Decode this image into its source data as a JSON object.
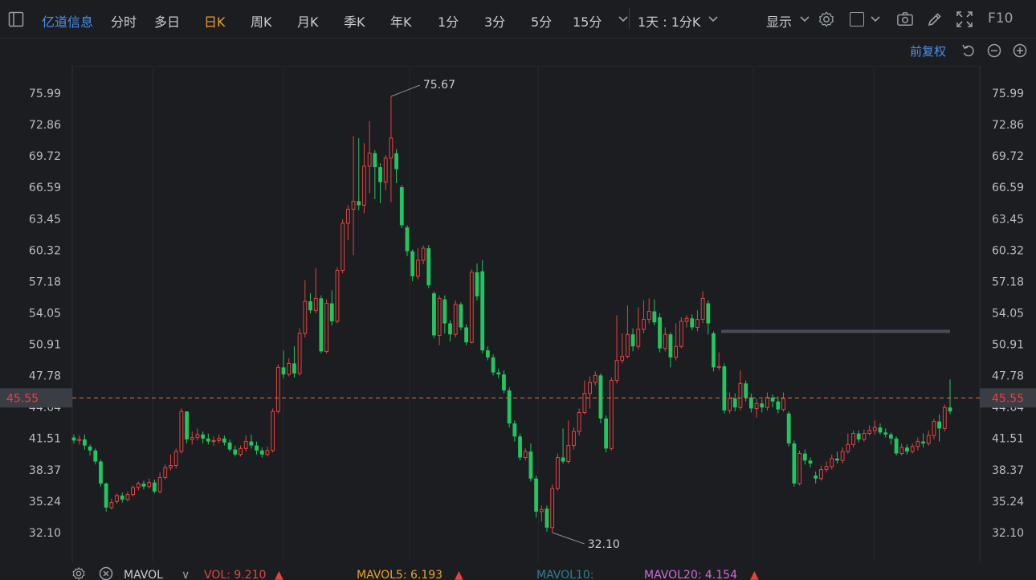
{
  "stock_name": "亿道信息",
  "periods": [
    "分时",
    "多日",
    "日K",
    "周K",
    "月K",
    "季K",
    "年K",
    "1分",
    "3分",
    "5分",
    "15分"
  ],
  "active_period": "日K",
  "interval_selector": "1天 : 1分K",
  "display_menu": "显示",
  "f10_label": "F10",
  "adjust_label": "前复权",
  "current_price": "45.55",
  "high_label": "75.67",
  "low_label": "32.10",
  "colors": {
    "up": "#e8423f",
    "down": "#22c55e",
    "accent": "#f0a020",
    "link": "#4d8fe8",
    "bg": "#1b1d21"
  },
  "chart_data": {
    "type": "candlestick",
    "y_ticks": [
      "75.99",
      "72.86",
      "69.72",
      "66.59",
      "63.45",
      "60.32",
      "57.18",
      "54.05",
      "50.91",
      "47.78",
      "44.64",
      "41.51",
      "38.37",
      "35.24",
      "32.10"
    ],
    "ylim": [
      32.1,
      75.99
    ],
    "reference_price": 45.55,
    "candles": [
      {
        "o": 41.6,
        "c": 41.3,
        "h": 41.9,
        "l": 41.0
      },
      {
        "o": 41.3,
        "c": 41.4,
        "h": 41.8,
        "l": 40.9
      },
      {
        "o": 41.4,
        "c": 40.8,
        "h": 41.9,
        "l": 40.4
      },
      {
        "o": 40.7,
        "c": 40.3,
        "h": 40.9,
        "l": 39.8
      },
      {
        "o": 40.3,
        "c": 39.2,
        "h": 40.5,
        "l": 38.9
      },
      {
        "o": 39.2,
        "c": 37.0,
        "h": 39.4,
        "l": 36.7
      },
      {
        "o": 37.0,
        "c": 34.6,
        "h": 37.1,
        "l": 34.2
      },
      {
        "o": 34.6,
        "c": 35.1,
        "h": 35.5,
        "l": 34.4
      },
      {
        "o": 35.2,
        "c": 35.8,
        "h": 36.0,
        "l": 35.0
      },
      {
        "o": 35.8,
        "c": 35.4,
        "h": 36.1,
        "l": 35.1
      },
      {
        "o": 35.4,
        "c": 35.9,
        "h": 36.2,
        "l": 35.2
      },
      {
        "o": 35.9,
        "c": 36.6,
        "h": 36.8,
        "l": 35.7
      },
      {
        "o": 36.6,
        "c": 37.0,
        "h": 37.2,
        "l": 36.3
      },
      {
        "o": 37.0,
        "c": 36.7,
        "h": 37.3,
        "l": 36.4
      },
      {
        "o": 36.7,
        "c": 37.1,
        "h": 37.5,
        "l": 36.5
      },
      {
        "o": 37.1,
        "c": 36.2,
        "h": 37.4,
        "l": 36.0
      },
      {
        "o": 36.2,
        "c": 37.6,
        "h": 38.1,
        "l": 36.0
      },
      {
        "o": 37.6,
        "c": 38.6,
        "h": 38.9,
        "l": 37.4
      },
      {
        "o": 38.6,
        "c": 38.8,
        "h": 39.9,
        "l": 38.3
      },
      {
        "o": 38.8,
        "c": 40.2,
        "h": 40.5,
        "l": 38.5
      },
      {
        "o": 40.2,
        "c": 44.2,
        "h": 44.5,
        "l": 40.0
      },
      {
        "o": 44.2,
        "c": 41.4,
        "h": 44.2,
        "l": 41.0
      },
      {
        "o": 41.4,
        "c": 41.6,
        "h": 42.2,
        "l": 40.9
      },
      {
        "o": 41.6,
        "c": 41.9,
        "h": 42.5,
        "l": 41.3
      },
      {
        "o": 41.9,
        "c": 41.5,
        "h": 42.2,
        "l": 41.0
      },
      {
        "o": 41.5,
        "c": 41.2,
        "h": 42.0,
        "l": 40.9
      },
      {
        "o": 41.2,
        "c": 41.3,
        "h": 41.7,
        "l": 40.8
      },
      {
        "o": 41.3,
        "c": 41.5,
        "h": 41.9,
        "l": 41.0
      },
      {
        "o": 41.5,
        "c": 41.1,
        "h": 41.8,
        "l": 40.8
      },
      {
        "o": 41.1,
        "c": 40.4,
        "h": 41.4,
        "l": 40.2
      },
      {
        "o": 40.4,
        "c": 39.9,
        "h": 40.8,
        "l": 39.7
      },
      {
        "o": 39.9,
        "c": 40.5,
        "h": 40.8,
        "l": 39.7
      },
      {
        "o": 40.5,
        "c": 41.2,
        "h": 41.8,
        "l": 40.2
      },
      {
        "o": 41.2,
        "c": 40.8,
        "h": 41.9,
        "l": 40.5
      },
      {
        "o": 40.8,
        "c": 40.3,
        "h": 41.2,
        "l": 39.9
      },
      {
        "o": 40.3,
        "c": 39.9,
        "h": 40.6,
        "l": 39.6
      },
      {
        "o": 39.9,
        "c": 40.3,
        "h": 40.7,
        "l": 39.7
      },
      {
        "o": 40.3,
        "c": 44.2,
        "h": 44.5,
        "l": 40.1
      },
      {
        "o": 44.2,
        "c": 48.6,
        "h": 48.9,
        "l": 44.0
      },
      {
        "o": 48.6,
        "c": 47.9,
        "h": 50.3,
        "l": 47.5
      },
      {
        "o": 47.9,
        "c": 49.0,
        "h": 49.5,
        "l": 47.7
      },
      {
        "o": 49.0,
        "c": 48.0,
        "h": 50.7,
        "l": 47.6
      },
      {
        "o": 48.0,
        "c": 52.0,
        "h": 52.5,
        "l": 47.8
      },
      {
        "o": 52.0,
        "c": 55.2,
        "h": 57.3,
        "l": 51.6
      },
      {
        "o": 55.2,
        "c": 54.3,
        "h": 56.0,
        "l": 54.0
      },
      {
        "o": 54.3,
        "c": 55.5,
        "h": 58.5,
        "l": 54.0
      },
      {
        "o": 55.5,
        "c": 50.2,
        "h": 55.8,
        "l": 50.0
      },
      {
        "o": 50.2,
        "c": 55.0,
        "h": 55.4,
        "l": 50.0
      },
      {
        "o": 55.0,
        "c": 53.2,
        "h": 56.3,
        "l": 52.8
      },
      {
        "o": 53.2,
        "c": 58.3,
        "h": 58.6,
        "l": 53.0
      },
      {
        "o": 58.3,
        "c": 63.0,
        "h": 63.4,
        "l": 58.0
      },
      {
        "o": 63.0,
        "c": 64.4,
        "h": 64.8,
        "l": 61.3
      },
      {
        "o": 64.4,
        "c": 65.2,
        "h": 71.7,
        "l": 59.8
      },
      {
        "o": 65.2,
        "c": 64.8,
        "h": 71.5,
        "l": 64.3
      },
      {
        "o": 64.8,
        "c": 68.7,
        "h": 71.0,
        "l": 64.0
      },
      {
        "o": 68.7,
        "c": 70.0,
        "h": 73.2,
        "l": 66.0
      },
      {
        "o": 70.0,
        "c": 68.6,
        "h": 70.3,
        "l": 65.4
      },
      {
        "o": 68.6,
        "c": 67.1,
        "h": 69.0,
        "l": 65.0
      },
      {
        "o": 67.1,
        "c": 69.5,
        "h": 69.8,
        "l": 66.3
      },
      {
        "o": 69.5,
        "c": 71.5,
        "h": 75.67,
        "l": 65.1
      },
      {
        "o": 70.0,
        "c": 68.4,
        "h": 70.4,
        "l": 67.0
      },
      {
        "o": 66.6,
        "c": 62.8,
        "h": 66.8,
        "l": 62.5
      },
      {
        "o": 62.6,
        "c": 60.2,
        "h": 62.8,
        "l": 59.7
      },
      {
        "o": 60.2,
        "c": 57.7,
        "h": 60.4,
        "l": 57.2
      },
      {
        "o": 57.7,
        "c": 59.3,
        "h": 60.5,
        "l": 57.4
      },
      {
        "o": 59.3,
        "c": 60.5,
        "h": 60.8,
        "l": 58.9
      },
      {
        "o": 60.5,
        "c": 56.8,
        "h": 60.8,
        "l": 56.5
      },
      {
        "o": 56.0,
        "c": 51.8,
        "h": 56.2,
        "l": 51.5
      },
      {
        "o": 51.8,
        "c": 55.5,
        "h": 55.8,
        "l": 50.8
      },
      {
        "o": 55.4,
        "c": 53.0,
        "h": 55.8,
        "l": 52.0
      },
      {
        "o": 53.0,
        "c": 51.9,
        "h": 53.3,
        "l": 51.2
      },
      {
        "o": 51.9,
        "c": 54.9,
        "h": 55.3,
        "l": 51.6
      },
      {
        "o": 54.9,
        "c": 52.6,
        "h": 55.1,
        "l": 52.3
      },
      {
        "o": 52.6,
        "c": 51.1,
        "h": 52.9,
        "l": 50.8
      },
      {
        "o": 51.1,
        "c": 58.1,
        "h": 58.4,
        "l": 51.0
      },
      {
        "o": 58.1,
        "c": 55.7,
        "h": 59.0,
        "l": 55.3
      },
      {
        "o": 58.2,
        "c": 50.3,
        "h": 59.3,
        "l": 50.0
      },
      {
        "o": 50.3,
        "c": 49.6,
        "h": 50.7,
        "l": 49.3
      },
      {
        "o": 49.6,
        "c": 48.1,
        "h": 49.9,
        "l": 47.8
      },
      {
        "o": 48.1,
        "c": 47.9,
        "h": 48.5,
        "l": 47.5
      },
      {
        "o": 47.9,
        "c": 46.3,
        "h": 48.3,
        "l": 46.0
      },
      {
        "o": 46.3,
        "c": 43.0,
        "h": 46.6,
        "l": 42.6
      },
      {
        "o": 43.0,
        "c": 41.7,
        "h": 43.3,
        "l": 41.2
      },
      {
        "o": 41.7,
        "c": 39.6,
        "h": 42.0,
        "l": 39.3
      },
      {
        "o": 39.6,
        "c": 40.2,
        "h": 40.5,
        "l": 39.3
      },
      {
        "o": 40.2,
        "c": 37.5,
        "h": 41.0,
        "l": 37.2
      },
      {
        "o": 37.5,
        "c": 34.2,
        "h": 37.8,
        "l": 33.6
      },
      {
        "o": 34.2,
        "c": 34.4,
        "h": 34.8,
        "l": 33.2
      },
      {
        "o": 34.5,
        "c": 32.6,
        "h": 34.8,
        "l": 32.2
      },
      {
        "o": 32.6,
        "c": 36.5,
        "h": 36.9,
        "l": 32.1
      },
      {
        "o": 36.5,
        "c": 39.6,
        "h": 40.0,
        "l": 36.3
      },
      {
        "o": 39.6,
        "c": 39.2,
        "h": 42.5,
        "l": 39.0
      },
      {
        "o": 39.2,
        "c": 40.8,
        "h": 43.3,
        "l": 39.0
      },
      {
        "o": 40.8,
        "c": 42.2,
        "h": 42.6,
        "l": 40.4
      },
      {
        "o": 42.2,
        "c": 44.1,
        "h": 44.5,
        "l": 41.8
      },
      {
        "o": 44.1,
        "c": 46.0,
        "h": 47.3,
        "l": 43.9
      },
      {
        "o": 46.0,
        "c": 47.1,
        "h": 47.7,
        "l": 44.5
      },
      {
        "o": 47.1,
        "c": 47.8,
        "h": 48.2,
        "l": 46.8
      },
      {
        "o": 47.8,
        "c": 43.5,
        "h": 48.0,
        "l": 43.0
      },
      {
        "o": 43.5,
        "c": 40.5,
        "h": 43.8,
        "l": 40.1
      },
      {
        "o": 40.5,
        "c": 47.3,
        "h": 47.6,
        "l": 40.3
      },
      {
        "o": 47.3,
        "c": 49.3,
        "h": 53.8,
        "l": 47.0
      },
      {
        "o": 49.3,
        "c": 49.7,
        "h": 52.0,
        "l": 49.0
      },
      {
        "o": 49.7,
        "c": 51.9,
        "h": 54.8,
        "l": 49.5
      },
      {
        "o": 51.9,
        "c": 50.7,
        "h": 52.5,
        "l": 50.2
      },
      {
        "o": 50.7,
        "c": 52.4,
        "h": 54.6,
        "l": 50.4
      },
      {
        "o": 52.4,
        "c": 53.4,
        "h": 55.3,
        "l": 52.0
      },
      {
        "o": 53.4,
        "c": 54.2,
        "h": 55.5,
        "l": 53.0
      },
      {
        "o": 54.2,
        "c": 53.1,
        "h": 55.4,
        "l": 52.8
      },
      {
        "o": 53.6,
        "c": 50.5,
        "h": 54.0,
        "l": 50.1
      },
      {
        "o": 50.5,
        "c": 51.9,
        "h": 52.6,
        "l": 50.2
      },
      {
        "o": 51.9,
        "c": 49.6,
        "h": 52.1,
        "l": 48.6
      },
      {
        "o": 49.6,
        "c": 50.7,
        "h": 53.0,
        "l": 49.3
      },
      {
        "o": 50.7,
        "c": 53.2,
        "h": 53.6,
        "l": 50.5
      },
      {
        "o": 53.2,
        "c": 53.5,
        "h": 53.8,
        "l": 52.6
      },
      {
        "o": 53.5,
        "c": 52.6,
        "h": 53.9,
        "l": 52.3
      },
      {
        "o": 52.6,
        "c": 53.4,
        "h": 54.3,
        "l": 52.2
      },
      {
        "o": 53.4,
        "c": 55.5,
        "h": 56.2,
        "l": 53.0
      },
      {
        "o": 55.0,
        "c": 53.0,
        "h": 55.3,
        "l": 51.9
      },
      {
        "o": 52.0,
        "c": 48.6,
        "h": 52.2,
        "l": 48.2
      },
      {
        "o": 48.6,
        "c": 48.7,
        "h": 50.1,
        "l": 48.3
      },
      {
        "o": 48.7,
        "c": 44.3,
        "h": 49.0,
        "l": 44.0
      },
      {
        "o": 44.3,
        "c": 45.5,
        "h": 46.1,
        "l": 44.0
      },
      {
        "o": 45.5,
        "c": 44.6,
        "h": 46.0,
        "l": 44.2
      },
      {
        "o": 44.6,
        "c": 47.0,
        "h": 48.3,
        "l": 44.3
      },
      {
        "o": 47.0,
        "c": 45.6,
        "h": 47.3,
        "l": 45.2
      },
      {
        "o": 45.6,
        "c": 44.5,
        "h": 46.0,
        "l": 44.1
      },
      {
        "o": 44.5,
        "c": 45.0,
        "h": 45.5,
        "l": 43.6
      },
      {
        "o": 45.0,
        "c": 44.6,
        "h": 45.4,
        "l": 44.1
      },
      {
        "o": 44.6,
        "c": 45.6,
        "h": 46.1,
        "l": 44.3
      },
      {
        "o": 45.6,
        "c": 45.2,
        "h": 45.9,
        "l": 44.6
      },
      {
        "o": 45.2,
        "c": 44.4,
        "h": 45.7,
        "l": 44.0
      },
      {
        "o": 44.4,
        "c": 45.5,
        "h": 46.1,
        "l": 44.2
      },
      {
        "o": 44.0,
        "c": 41.0,
        "h": 44.2,
        "l": 40.7
      },
      {
        "o": 41.0,
        "c": 37.0,
        "h": 41.3,
        "l": 36.7
      },
      {
        "o": 37.0,
        "c": 40.0,
        "h": 40.3,
        "l": 36.8
      },
      {
        "o": 40.0,
        "c": 39.3,
        "h": 40.4,
        "l": 38.9
      },
      {
        "o": 39.3,
        "c": 39.0,
        "h": 39.6,
        "l": 38.6
      },
      {
        "o": 37.8,
        "c": 37.5,
        "h": 38.2,
        "l": 37.0
      },
      {
        "o": 37.5,
        "c": 38.4,
        "h": 38.8,
        "l": 37.3
      },
      {
        "o": 38.4,
        "c": 38.7,
        "h": 39.2,
        "l": 38.1
      },
      {
        "o": 38.7,
        "c": 39.5,
        "h": 39.9,
        "l": 38.4
      },
      {
        "o": 39.5,
        "c": 39.3,
        "h": 40.2,
        "l": 39.0
      },
      {
        "o": 39.3,
        "c": 40.2,
        "h": 40.6,
        "l": 39.0
      },
      {
        "o": 40.2,
        "c": 40.9,
        "h": 42.0,
        "l": 40.0
      },
      {
        "o": 40.9,
        "c": 42.0,
        "h": 42.3,
        "l": 40.6
      },
      {
        "o": 42.0,
        "c": 41.4,
        "h": 42.3,
        "l": 41.1
      },
      {
        "o": 41.4,
        "c": 42.0,
        "h": 42.4,
        "l": 41.2
      },
      {
        "o": 42.0,
        "c": 42.3,
        "h": 42.8,
        "l": 41.8
      },
      {
        "o": 42.3,
        "c": 42.6,
        "h": 43.3,
        "l": 41.9
      },
      {
        "o": 42.6,
        "c": 42.1,
        "h": 43.0,
        "l": 41.9
      },
      {
        "o": 42.1,
        "c": 41.9,
        "h": 42.5,
        "l": 41.6
      },
      {
        "o": 41.9,
        "c": 41.5,
        "h": 42.1,
        "l": 40.9
      },
      {
        "o": 41.5,
        "c": 40.0,
        "h": 41.7,
        "l": 39.8
      },
      {
        "o": 40.0,
        "c": 40.6,
        "h": 41.0,
        "l": 39.8
      },
      {
        "o": 40.6,
        "c": 40.2,
        "h": 40.9,
        "l": 39.9
      },
      {
        "o": 40.2,
        "c": 40.7,
        "h": 41.0,
        "l": 40.0
      },
      {
        "o": 40.7,
        "c": 41.2,
        "h": 41.6,
        "l": 40.3
      },
      {
        "o": 41.2,
        "c": 41.0,
        "h": 42.0,
        "l": 40.6
      },
      {
        "o": 41.0,
        "c": 41.8,
        "h": 42.3,
        "l": 40.8
      },
      {
        "o": 41.8,
        "c": 43.2,
        "h": 43.5,
        "l": 41.4
      },
      {
        "o": 43.2,
        "c": 42.5,
        "h": 43.9,
        "l": 41.2
      },
      {
        "o": 42.5,
        "c": 44.6,
        "h": 44.9,
        "l": 42.2
      },
      {
        "o": 44.6,
        "c": 44.2,
        "h": 47.4,
        "l": 43.9
      }
    ]
  },
  "volume_bar": {
    "indicator": "MAVOL",
    "vol": "VOL: 9.210",
    "ma5": "MAVOL5: 6.193",
    "ma10": "MAVOL10:",
    "ma20": "MAVOL20: 4.154"
  }
}
